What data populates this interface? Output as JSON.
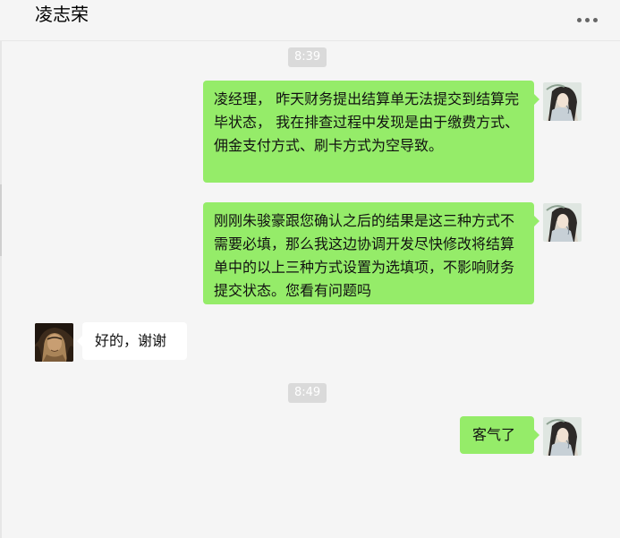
{
  "chat": {
    "title": "凌志荣",
    "more_icon": "more-horizontal-icon"
  },
  "times": [
    "8:39",
    "8:49"
  ],
  "messages": [
    {
      "direction": "outgoing",
      "text": "凌经理， 昨天财务提出结算单无法提交到结算完毕状态， 我在排查过程中发现是由于缴费方式、佣金支付方式、刷卡方式为空导致。"
    },
    {
      "direction": "outgoing",
      "text": "刚刚朱骏豪跟您确认之后的结果是这三种方式不需要必填，那么我这边协调开发尽快修改将结算单中的以上三种方式设置为选填项，不影响财务提交状态。您看有问题吗"
    },
    {
      "direction": "incoming",
      "text": "好的，谢谢"
    },
    {
      "direction": "outgoing",
      "text": "客气了"
    }
  ],
  "colors": {
    "background": "#f5f5f5",
    "outgoing_bubble": "#95ec69",
    "incoming_bubble": "#ffffff",
    "timestamp_bg": "#dadada"
  }
}
